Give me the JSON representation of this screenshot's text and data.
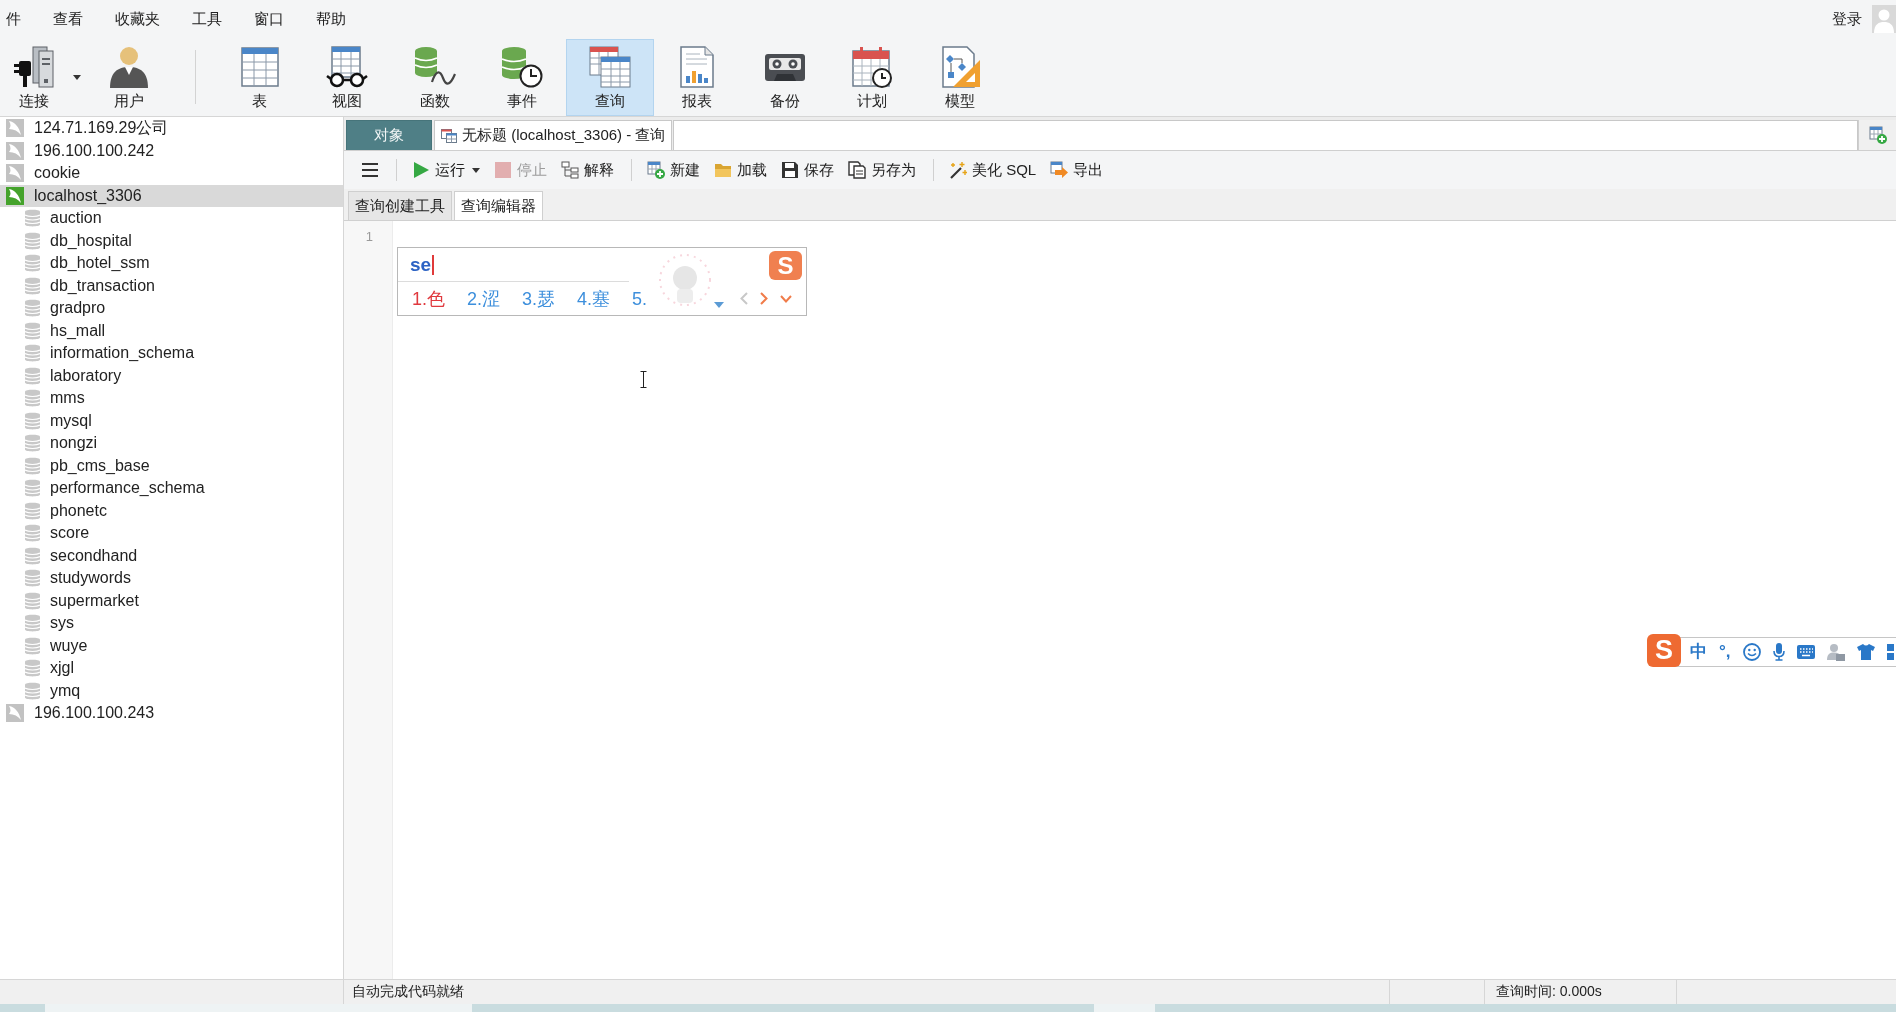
{
  "menu": [
    "件",
    "查看",
    "收藏夹",
    "工具",
    "窗口",
    "帮助"
  ],
  "account": {
    "label": "登录"
  },
  "toolbar": [
    [
      {
        "kind": "connection",
        "label": "连接",
        "has_menu": true,
        "selected": false
      },
      {
        "kind": "user",
        "label": "用户",
        "has_menu": false,
        "selected": false
      }
    ],
    [
      {
        "kind": "table",
        "label": "表",
        "has_menu": false,
        "selected": false
      },
      {
        "kind": "view",
        "label": "视图",
        "has_menu": false,
        "selected": false
      },
      {
        "kind": "function",
        "label": "函数",
        "has_menu": false,
        "selected": false
      },
      {
        "kind": "event",
        "label": "事件",
        "has_menu": false,
        "selected": false
      },
      {
        "kind": "query",
        "label": "查询",
        "has_menu": false,
        "selected": true
      },
      {
        "kind": "report",
        "label": "报表",
        "has_menu": false,
        "selected": false
      },
      {
        "kind": "backup",
        "label": "备份",
        "has_menu": false,
        "selected": false
      },
      {
        "kind": "schedule",
        "label": "计划",
        "has_menu": false,
        "selected": false
      },
      {
        "kind": "model",
        "label": "模型",
        "has_menu": false,
        "selected": false
      }
    ]
  ],
  "sidebar": {
    "connections": [
      {
        "name": "124.71.169.29公司",
        "selected": false,
        "connected": false
      },
      {
        "name": "196.100.100.242",
        "selected": false,
        "connected": false
      },
      {
        "name": "cookie",
        "selected": false,
        "connected": false
      },
      {
        "name": "localhost_3306",
        "selected": true,
        "connected": true,
        "children": [
          {
            "name": "auction",
            "selected": false
          },
          {
            "name": "db_hospital",
            "selected": false
          },
          {
            "name": "db_hotel_ssm",
            "selected": false
          },
          {
            "name": "db_transaction",
            "selected": false
          },
          {
            "name": "gradpro",
            "selected": false
          },
          {
            "name": "hs_mall",
            "selected": false
          },
          {
            "name": "information_schema",
            "selected": false
          },
          {
            "name": "laboratory",
            "selected": false
          },
          {
            "name": "mms",
            "selected": false
          },
          {
            "name": "mysql",
            "selected": false
          },
          {
            "name": "nongzi",
            "selected": false
          },
          {
            "name": "pb_cms_base",
            "selected": false
          },
          {
            "name": "performance_schema",
            "selected": false
          },
          {
            "name": "phonetc",
            "selected": false
          },
          {
            "name": "score",
            "selected": false
          },
          {
            "name": "secondhand",
            "selected": false
          },
          {
            "name": "studywords",
            "selected": false
          },
          {
            "name": "supermarket",
            "selected": false
          },
          {
            "name": "sys",
            "selected": false
          },
          {
            "name": "wuye",
            "selected": false
          },
          {
            "name": "xjgl",
            "selected": false
          },
          {
            "name": "ymq",
            "selected": false
          }
        ]
      },
      {
        "name": "196.100.100.243",
        "selected": false,
        "connected": false
      }
    ]
  },
  "editor_tabs": [
    {
      "kind": "objects",
      "label": "对象",
      "selected": false
    },
    {
      "kind": "query",
      "label": "无标题 (localhost_3306) - 查询",
      "selected": true
    }
  ],
  "query_toolbar": [
    [
      {
        "kind": "menu",
        "has_menu": false,
        "disabled": false
      }
    ],
    [
      {
        "kind": "run",
        "label": "运行",
        "has_menu": true,
        "disabled": false
      },
      {
        "kind": "stop",
        "label": "停止",
        "has_menu": false,
        "disabled": true
      },
      {
        "kind": "explain",
        "label": "解释",
        "has_menu": false,
        "disabled": false
      }
    ],
    [
      {
        "kind": "new",
        "label": "新建",
        "has_menu": false,
        "disabled": false
      },
      {
        "kind": "load",
        "label": "加载",
        "has_menu": false,
        "disabled": false
      },
      {
        "kind": "save",
        "label": "保存",
        "has_menu": false,
        "disabled": false
      },
      {
        "kind": "save_as",
        "label": "另存为",
        "has_menu": false,
        "disabled": false
      }
    ],
    [
      {
        "kind": "beautify",
        "label": "美化 SQL",
        "has_menu": false,
        "disabled": false
      },
      {
        "kind": "export",
        "label": "导出",
        "has_menu": false,
        "disabled": false
      }
    ]
  ],
  "sub_tabs": [
    {
      "label": "查询创建工具",
      "selected": false
    },
    {
      "label": "查询编辑器",
      "selected": true
    }
  ],
  "editor": {
    "line_numbers": [
      "1"
    ]
  },
  "ime_popup": {
    "logo": "S",
    "input": "se",
    "candidates": [
      {
        "label": "1.色",
        "selected": true
      },
      {
        "label": "2.涩",
        "selected": false
      },
      {
        "label": "3.瑟",
        "selected": false
      },
      {
        "label": "4.塞",
        "selected": false
      },
      {
        "label": "5.",
        "selected": false
      }
    ],
    "can_page_back": false
  },
  "ime_toolbar": {
    "logo": "S",
    "mode": "中",
    "punctuation": "°,"
  },
  "status_bar": {
    "message": "自动完成代码就绪",
    "query_time": "查询时间: 0.000s"
  }
}
